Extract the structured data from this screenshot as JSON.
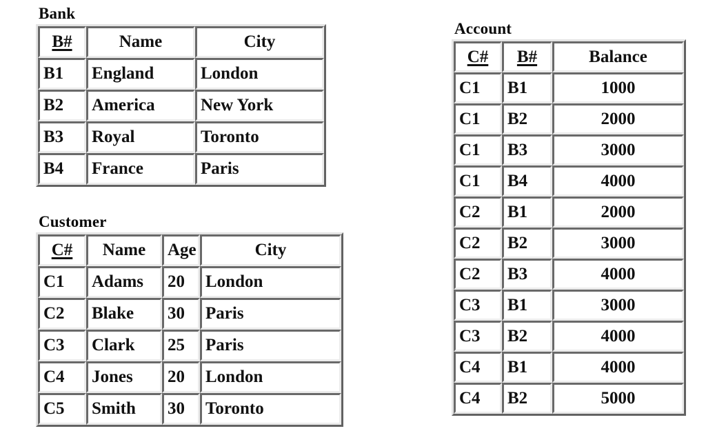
{
  "page": {
    "background_color": "#ffffff",
    "border_color": "#c0c0c0",
    "text_color": "#111111"
  },
  "tables": {
    "bank": {
      "title": "Bank",
      "columns": [
        {
          "label": "B#",
          "primary_key": true,
          "align": "center"
        },
        {
          "label": "Name",
          "primary_key": false,
          "align": "center"
        },
        {
          "label": "City",
          "primary_key": false,
          "align": "center"
        }
      ],
      "rows": [
        [
          "B1",
          "England",
          "London"
        ],
        [
          "B2",
          "America",
          "New York"
        ],
        [
          "B3",
          "Royal",
          "Toronto"
        ],
        [
          "B4",
          "France",
          "Paris"
        ]
      ]
    },
    "customer": {
      "title": "Customer",
      "columns": [
        {
          "label": "C#",
          "primary_key": true,
          "align": "center"
        },
        {
          "label": "Name",
          "primary_key": false,
          "align": "center"
        },
        {
          "label": "Age",
          "primary_key": false,
          "align": "center"
        },
        {
          "label": "City",
          "primary_key": false,
          "align": "center"
        }
      ],
      "rows": [
        [
          "C1",
          "Adams",
          "20",
          "London"
        ],
        [
          "C2",
          "Blake",
          "30",
          "Paris"
        ],
        [
          "C3",
          "Clark",
          "25",
          "Paris"
        ],
        [
          "C4",
          "Jones",
          "20",
          "London"
        ],
        [
          "C5",
          "Smith",
          "30",
          "Toronto"
        ]
      ]
    },
    "account": {
      "title": "Account",
      "columns": [
        {
          "label": "C#",
          "primary_key": true,
          "align": "center"
        },
        {
          "label": "B#",
          "primary_key": true,
          "align": "center"
        },
        {
          "label": "Balance",
          "primary_key": false,
          "align": "center"
        }
      ],
      "rows": [
        [
          "C1",
          "B1",
          "1000"
        ],
        [
          "C1",
          "B2",
          "2000"
        ],
        [
          "C1",
          "B3",
          "3000"
        ],
        [
          "C1",
          "B4",
          "4000"
        ],
        [
          "C2",
          "B1",
          "2000"
        ],
        [
          "C2",
          "B2",
          "3000"
        ],
        [
          "C2",
          "B3",
          "4000"
        ],
        [
          "C3",
          "B1",
          "3000"
        ],
        [
          "C3",
          "B2",
          "4000"
        ],
        [
          "C4",
          "B1",
          "4000"
        ],
        [
          "C4",
          "B2",
          "5000"
        ]
      ],
      "cell_align": [
        "left",
        "left",
        "center"
      ]
    }
  }
}
